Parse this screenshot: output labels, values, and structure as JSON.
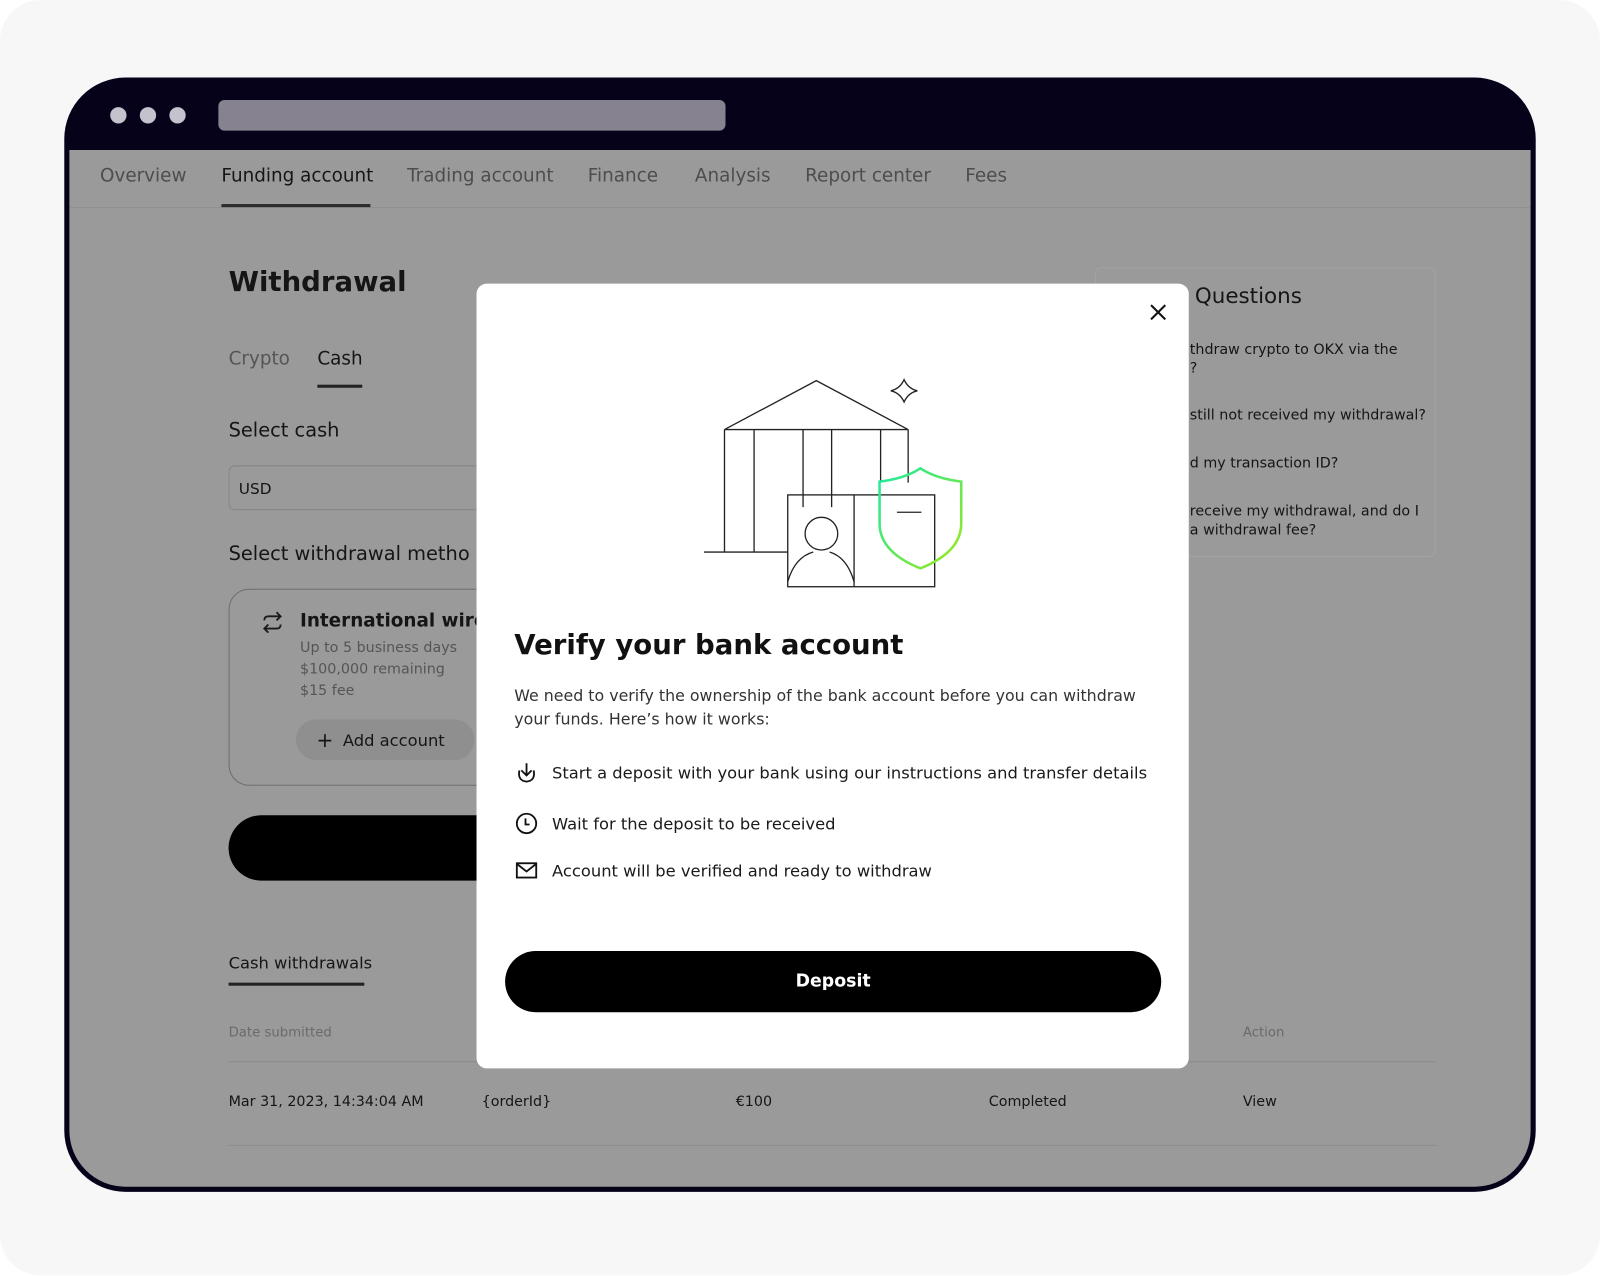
{
  "nav": {
    "items": [
      {
        "label": "Overview"
      },
      {
        "label": "Funding account",
        "active": true
      },
      {
        "label": "Trading account"
      },
      {
        "label": "Finance"
      },
      {
        "label": "Analysis"
      },
      {
        "label": "Report center"
      },
      {
        "label": "Fees"
      }
    ]
  },
  "withdrawal": {
    "title": "Withdrawal",
    "tabs": [
      {
        "label": "Crypto"
      },
      {
        "label": "Cash",
        "active": true
      }
    ],
    "select_cash_label": "Select cash",
    "currency_value": "USD",
    "method_label": "Select withdrawal metho",
    "method": {
      "name": "International wire",
      "icon": "swap-arrows-icon",
      "details": [
        "Up to 5 business days",
        "$100,000 remaining",
        "$15 fee"
      ],
      "add_account_label": "Add account"
    }
  },
  "history": {
    "tab": "Cash withdrawals",
    "headers": {
      "date": "Date submitted",
      "action": "Action"
    },
    "rows": [
      {
        "date": "Mar 31, 2023, 14:34:04 AM",
        "order": "{orderId}",
        "amount": "€100",
        "status": "Completed",
        "action": "View"
      }
    ]
  },
  "faq": {
    "title": "Questions",
    "items": [
      {
        "line1": "thdraw crypto to OKX via the",
        "line2": "?"
      },
      {
        "line1": "still not received my withdrawal?",
        "line2": ""
      },
      {
        "line1": "d my transaction ID?",
        "line2": ""
      },
      {
        "line1": "receive my withdrawal, and do I",
        "line2": "a withdrawal fee?"
      }
    ]
  },
  "modal": {
    "title": "Verify your bank account",
    "description_line1": "We need to verify the ownership of the bank account before you can withdraw",
    "description_line2": "your funds. Here’s how it works:",
    "steps": [
      {
        "icon": "download-icon",
        "text": "Start a deposit with your bank using our instructions and transfer details"
      },
      {
        "icon": "clock-icon",
        "text": "Wait for the deposit to be received"
      },
      {
        "icon": "mail-icon",
        "text": "Account will be verified and ready to withdraw"
      }
    ],
    "primary_label": "Deposit",
    "shield_gradient": [
      "#1de9a0",
      "#9ee81c"
    ]
  },
  "colors": {
    "frame": "#05021a",
    "overlay": "#9a9a9a",
    "button": "#000000"
  }
}
